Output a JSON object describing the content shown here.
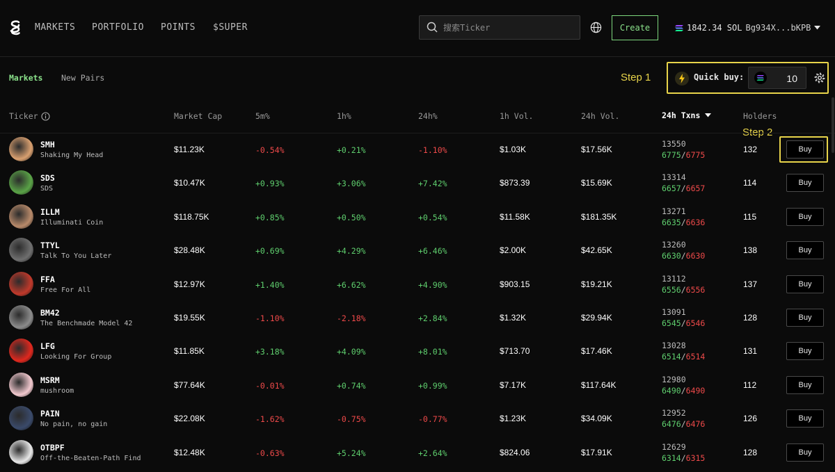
{
  "nav": {
    "items": [
      {
        "label": "MARKETS",
        "active": true
      },
      {
        "label": "PORTFOLIO",
        "active": false
      },
      {
        "label": "POINTS",
        "active": false
      },
      {
        "label": "$SUPER",
        "active": false
      }
    ],
    "search_placeholder": "搜索Ticker",
    "create_label": "Create",
    "wallet": {
      "balance": "1842.34 SOL",
      "address": "Bg934X...bKPB"
    }
  },
  "subtabs": [
    {
      "label": "Markets",
      "active": true
    },
    {
      "label": "New Pairs",
      "active": false
    }
  ],
  "annotations": {
    "step1": "Step 1",
    "step2": "Step 2",
    "highlight_color": "#e8d44a"
  },
  "quick_buy": {
    "label": "Quick buy:",
    "amount": "10"
  },
  "colors": {
    "accent": "#8be28b",
    "positive": "#5fcf6e",
    "negative": "#ef4a4a"
  },
  "table": {
    "headers": [
      "Ticker",
      "Market Cap",
      "5m%",
      "1h%",
      "24h%",
      "1h Vol.",
      "24h Vol.",
      "24h Txns",
      "Holders"
    ],
    "sorted_by": "24h Txns",
    "buy_label": "Buy",
    "rows": [
      {
        "symbol": "SMH",
        "name": "Shaking My Head",
        "market_cap": "$11.23K",
        "m5": "-0.54%",
        "h1": "+0.21%",
        "h24": "-1.10%",
        "vol1h": "$1.03K",
        "vol24h": "$17.56K",
        "txns": "13550",
        "buys": "6775",
        "sells": "6775",
        "holders": "132",
        "avatar_color": "#d9a070"
      },
      {
        "symbol": "SDS",
        "name": "SDS",
        "market_cap": "$10.47K",
        "m5": "+0.93%",
        "h1": "+3.06%",
        "h24": "+7.42%",
        "vol1h": "$873.39",
        "vol24h": "$15.69K",
        "txns": "13314",
        "buys": "6657",
        "sells": "6657",
        "holders": "114",
        "avatar_color": "#5aa347"
      },
      {
        "symbol": "ILLM",
        "name": "Illuminati Coin",
        "market_cap": "$118.75K",
        "m5": "+0.85%",
        "h1": "+0.50%",
        "h24": "+0.54%",
        "vol1h": "$11.58K",
        "vol24h": "$181.35K",
        "txns": "13271",
        "buys": "6635",
        "sells": "6636",
        "holders": "115",
        "avatar_color": "#b88a6a"
      },
      {
        "symbol": "TTYL",
        "name": "Talk To You Later",
        "market_cap": "$28.48K",
        "m5": "+0.69%",
        "h1": "+4.29%",
        "h24": "+6.46%",
        "vol1h": "$2.00K",
        "vol24h": "$42.65K",
        "txns": "13260",
        "buys": "6630",
        "sells": "6630",
        "holders": "138",
        "avatar_color": "#6f6f6f"
      },
      {
        "symbol": "FFA",
        "name": "Free For All",
        "market_cap": "$12.97K",
        "m5": "+1.40%",
        "h1": "+6.62%",
        "h24": "+4.90%",
        "vol1h": "$903.15",
        "vol24h": "$19.21K",
        "txns": "13112",
        "buys": "6556",
        "sells": "6556",
        "holders": "137",
        "avatar_color": "#c0392b"
      },
      {
        "symbol": "BM42",
        "name": "The Benchmade Model 42",
        "market_cap": "$19.55K",
        "m5": "-1.10%",
        "h1": "-2.18%",
        "h24": "+2.84%",
        "vol1h": "$1.32K",
        "vol24h": "$29.94K",
        "txns": "13091",
        "buys": "6545",
        "sells": "6546",
        "holders": "128",
        "avatar_color": "#8c8c8c"
      },
      {
        "symbol": "LFG",
        "name": "Looking For Group",
        "market_cap": "$11.85K",
        "m5": "+3.18%",
        "h1": "+4.09%",
        "h24": "+8.01%",
        "vol1h": "$713.70",
        "vol24h": "$17.46K",
        "txns": "13028",
        "buys": "6514",
        "sells": "6514",
        "holders": "131",
        "avatar_color": "#e0281e"
      },
      {
        "symbol": "MSRM",
        "name": "mushroom",
        "market_cap": "$77.64K",
        "m5": "-0.01%",
        "h1": "+0.74%",
        "h24": "+0.99%",
        "vol1h": "$7.17K",
        "vol24h": "$117.64K",
        "txns": "12980",
        "buys": "6490",
        "sells": "6490",
        "holders": "112",
        "avatar_color": "#f2c9cf"
      },
      {
        "symbol": "PAIN",
        "name": "No pain, no gain",
        "market_cap": "$22.08K",
        "m5": "-1.62%",
        "h1": "-0.75%",
        "h24": "-0.77%",
        "vol1h": "$1.23K",
        "vol24h": "$34.09K",
        "txns": "12952",
        "buys": "6476",
        "sells": "6476",
        "holders": "126",
        "avatar_color": "#3a4a6a"
      },
      {
        "symbol": "OTBPF",
        "name": "Off-the-Beaten-Path Find",
        "market_cap": "$12.48K",
        "m5": "-0.63%",
        "h1": "+5.24%",
        "h24": "+2.64%",
        "vol1h": "$824.06",
        "vol24h": "$17.91K",
        "txns": "12629",
        "buys": "6314",
        "sells": "6315",
        "holders": "128",
        "avatar_color": "#e8e8e8"
      }
    ]
  }
}
